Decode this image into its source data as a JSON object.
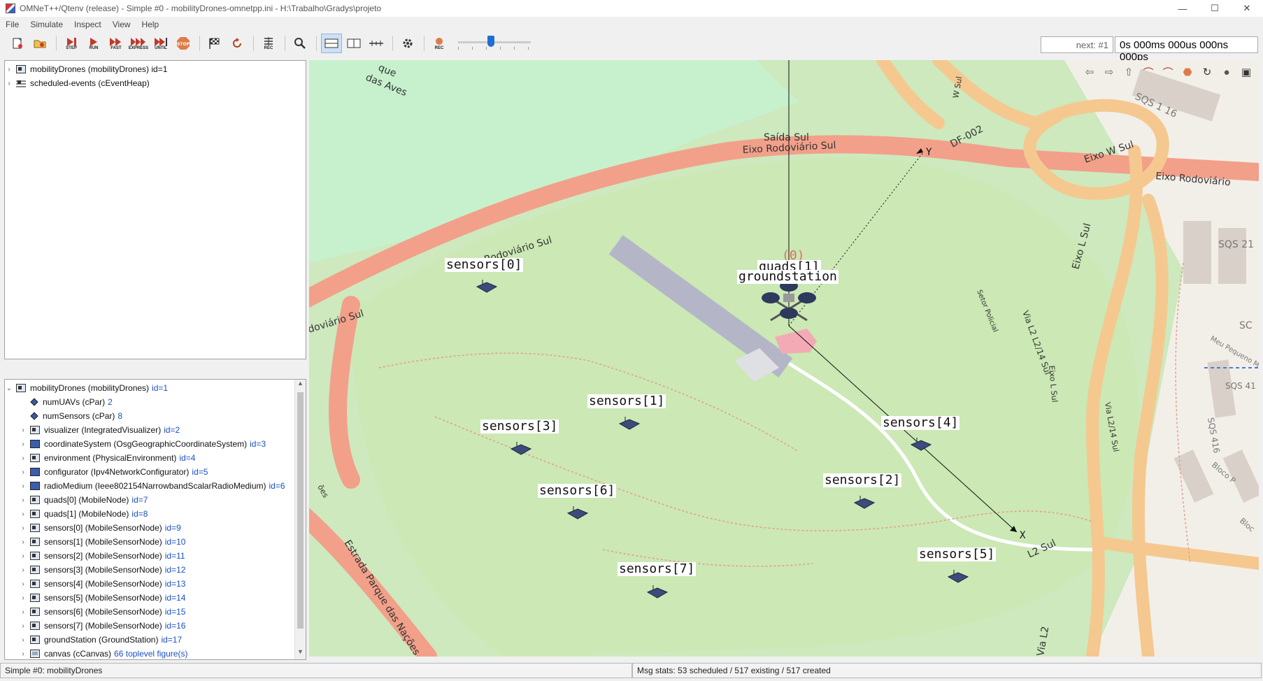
{
  "window": {
    "title": "OMNeT++/Qtenv (release) - Simple #0 - mobilityDrones-omnetpp.ini - H:\\Trabalho\\Gradys\\projeto",
    "minimize": "—",
    "maximize": "☐",
    "close": "✕"
  },
  "menu": [
    "File",
    "Simulate",
    "Inspect",
    "View",
    "Help"
  ],
  "toolbar": {
    "captions": {
      "step": "STEP",
      "run": "RUN",
      "fast": "FAST",
      "express": "EXPRESS",
      "until": "UNTIL",
      "stop": "STOP",
      "rec": "REC",
      "rec2": "REC"
    },
    "speed_level": 0.45,
    "next_event": "next: #1",
    "sim_time": "0s 000ms 000us 000ns 000ps"
  },
  "object_tree": [
    {
      "label": "mobilityDrones (mobilityDrones) id=1",
      "icon": "module-icon"
    },
    {
      "label": "scheduled-events (cEventHeap)",
      "icon": "heap-icon"
    }
  ],
  "inspector": {
    "rows": [
      {
        "label": "mobilityDrones (mobilityDrones)",
        "value": "id=1",
        "indent": 0,
        "icon": "module",
        "expanded": true
      },
      {
        "label": "numUAVs (cPar)",
        "value": "2",
        "indent": 1,
        "icon": "diamond"
      },
      {
        "label": "numSensors (cPar)",
        "value": "8",
        "indent": 1,
        "icon": "diamond"
      },
      {
        "label": "visualizer (IntegratedVisualizer)",
        "value": "id=2",
        "indent": 1,
        "icon": "module"
      },
      {
        "label": "coordinateSystem (OsgGeographicCoordinateSystem)",
        "value": "id=3",
        "indent": 1,
        "icon": "flat"
      },
      {
        "label": "environment (PhysicalEnvironment)",
        "value": "id=4",
        "indent": 1,
        "icon": "module"
      },
      {
        "label": "configurator (Ipv4NetworkConfigurator)",
        "value": "id=5",
        "indent": 1,
        "icon": "flat"
      },
      {
        "label": "radioMedium (Ieee802154NarrowbandScalarRadioMedium)",
        "value": "id=6",
        "indent": 1,
        "icon": "flat"
      },
      {
        "label": "quads[0] (MobileNode)",
        "value": "id=7",
        "indent": 1,
        "icon": "module"
      },
      {
        "label": "quads[1] (MobileNode)",
        "value": "id=8",
        "indent": 1,
        "icon": "module"
      },
      {
        "label": "sensors[0] (MobileSensorNode)",
        "value": "id=9",
        "indent": 1,
        "icon": "module"
      },
      {
        "label": "sensors[1] (MobileSensorNode)",
        "value": "id=10",
        "indent": 1,
        "icon": "module"
      },
      {
        "label": "sensors[2] (MobileSensorNode)",
        "value": "id=11",
        "indent": 1,
        "icon": "module"
      },
      {
        "label": "sensors[3] (MobileSensorNode)",
        "value": "id=12",
        "indent": 1,
        "icon": "module"
      },
      {
        "label": "sensors[4] (MobileSensorNode)",
        "value": "id=13",
        "indent": 1,
        "icon": "module"
      },
      {
        "label": "sensors[5] (MobileSensorNode)",
        "value": "id=14",
        "indent": 1,
        "icon": "module"
      },
      {
        "label": "sensors[6] (MobileSensorNode)",
        "value": "id=15",
        "indent": 1,
        "icon": "module"
      },
      {
        "label": "sensors[7] (MobileSensorNode)",
        "value": "id=16",
        "indent": 1,
        "icon": "module"
      },
      {
        "label": "groundStation (GroundStation)",
        "value": "id=17",
        "indent": 1,
        "icon": "module"
      },
      {
        "label": "canvas (cCanvas)",
        "value": "66 toplevel figure(s)",
        "indent": 1,
        "icon": "canvas"
      }
    ]
  },
  "map": {
    "labels": {
      "sensors0": "sensors[0]",
      "sensors1": "sensors[1]",
      "sensors2": "sensors[2]",
      "sensors3": "sensors[3]",
      "sensors4": "sensors[4]",
      "sensors5": "sensors[5]",
      "sensors6": "sensors[6]",
      "sensors7": "sensors[7]",
      "quads1": "quads[1]",
      "groundstation": "groundstation",
      "origin": "(0)",
      "axis_x": "X",
      "axis_y": "Y"
    },
    "streets": {
      "eixo1": "Eixo Rodoviário Sul",
      "eixo2": "Eixo Rodoviário Sul",
      "eixo3": "Eixo Rodoviário",
      "rodoviario": "doviário Sul",
      "saida": "Saída Sul",
      "df": "DF-002",
      "eixow": "Eixo W Sul",
      "eixol": "Eixo L Sul",
      "eixol2": "Eixo L Sul",
      "vial2": "Via L2 L2/14 Sul",
      "vial214": "Via L2/14 Sul",
      "setor": "Setor Policial",
      "l2sul": "L2 Sul",
      "via": "Via L2",
      "estrada": "Estrada Parque das Nações",
      "parque": "que",
      "aves": "das Aves",
      "sqs116": "SQS 1 16",
      "sqs21": "SQS 21",
      "sqs41": "SQS 41",
      "sqs416": "SQS 416",
      "sc": "SC",
      "bloco": "Bloco P",
      "bloc": "Bloc",
      "mundo": "Meu Pequeno Mundo",
      "wsul": "W Sul",
      "nacoes": "ões"
    }
  },
  "status": {
    "left": "Simple #0: mobilityDrones",
    "msg": "Msg stats: 53 scheduled / 517 existing / 517 created"
  }
}
